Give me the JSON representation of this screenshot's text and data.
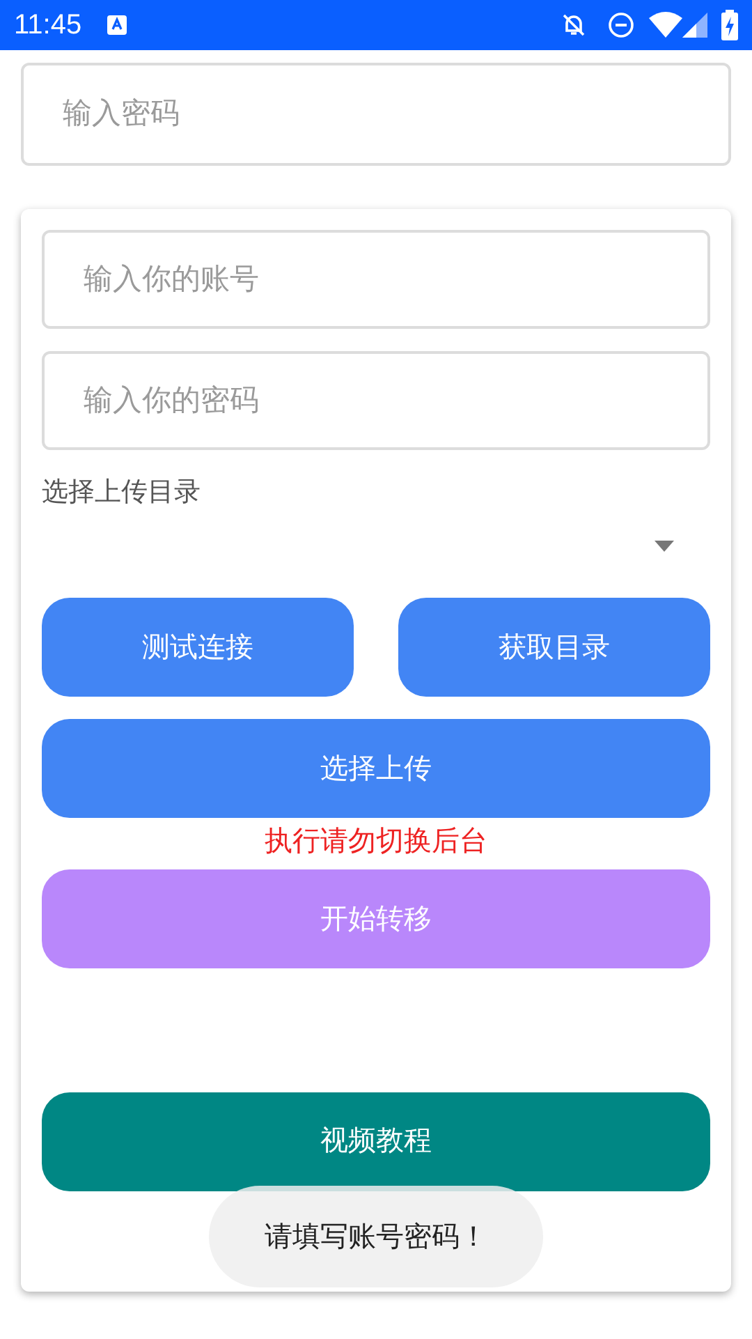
{
  "status_bar": {
    "time": "11:45"
  },
  "top_field": {
    "placeholder": "输入密码"
  },
  "form": {
    "account_field": {
      "placeholder": "输入你的账号"
    },
    "password_field": {
      "placeholder": "输入你的密码"
    },
    "directory_label": "选择上传目录",
    "buttons_row": [
      {
        "label": "测试连接"
      },
      {
        "label": "获取目录"
      }
    ],
    "upload_button": "选择上传",
    "warning": "执行请勿切换后台",
    "transfer_button": "开始转移",
    "tutorial_button": "视频教程"
  },
  "toast": "请填写账号密码！"
}
